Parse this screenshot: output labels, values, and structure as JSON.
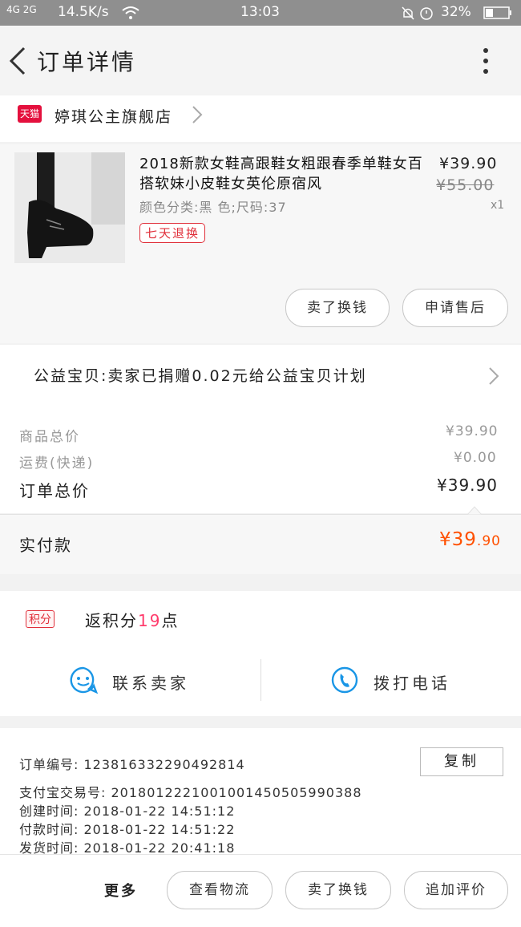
{
  "status": {
    "network": "4G 2G",
    "speed": "14.5K/s",
    "time": "13:03",
    "battery": "32%"
  },
  "header": {
    "title": "订单详情",
    "back_icon": "chevron-left-icon",
    "menu_icon": "more-vertical-icon"
  },
  "store": {
    "badge": "天猫",
    "name": "婷琪公主旗舰店"
  },
  "product": {
    "name": "2018新款女鞋高跟鞋女粗跟春季单鞋女百搭软妹小皮鞋女英伦原宿风",
    "price": "¥39.90",
    "original_price": "¥55.00",
    "quantity": "x1",
    "spec": "颜色分类:黑  色;尺码:37",
    "badge": "七天退换",
    "btn_sell": "卖了换钱",
    "btn_aftersale": "申请售后"
  },
  "charity": {
    "text": "公益宝贝:卖家已捐赠0.02元给公益宝贝计划"
  },
  "totals": {
    "goods_label": "商品总价",
    "goods_value": "¥39.90",
    "shipping_label": "运费(快递)",
    "shipping_value": "¥0.00",
    "order_label": "订单总价",
    "order_value": "¥39.90"
  },
  "paid": {
    "label": "实付款",
    "currency": "¥",
    "int": "39",
    "dec": ".90"
  },
  "points": {
    "badge": "积分",
    "text_prefix": "返积分",
    "count": "19",
    "text_suffix": "点"
  },
  "actions": {
    "contact": "联系卖家",
    "call": "拨打电话"
  },
  "order_info": {
    "order_no": "订单编号:  123816332290492814",
    "alipay_no": "支付宝交易号:  2018012221001001450505990388",
    "created": "创建时间:  2018-01-22  14:51:12",
    "paid": "付款时间:  2018-01-22  14:51:22",
    "shipped": "发货时间:  2018-01-22  20:41:18",
    "copy": "复制"
  },
  "bottom": {
    "more": "更多",
    "logistics": "查看物流",
    "sell": "卖了换钱",
    "review": "追加评价"
  },
  "colors": {
    "accent": "#ff5000",
    "tmall": "#e4103d",
    "blue": "#1a96e6"
  }
}
